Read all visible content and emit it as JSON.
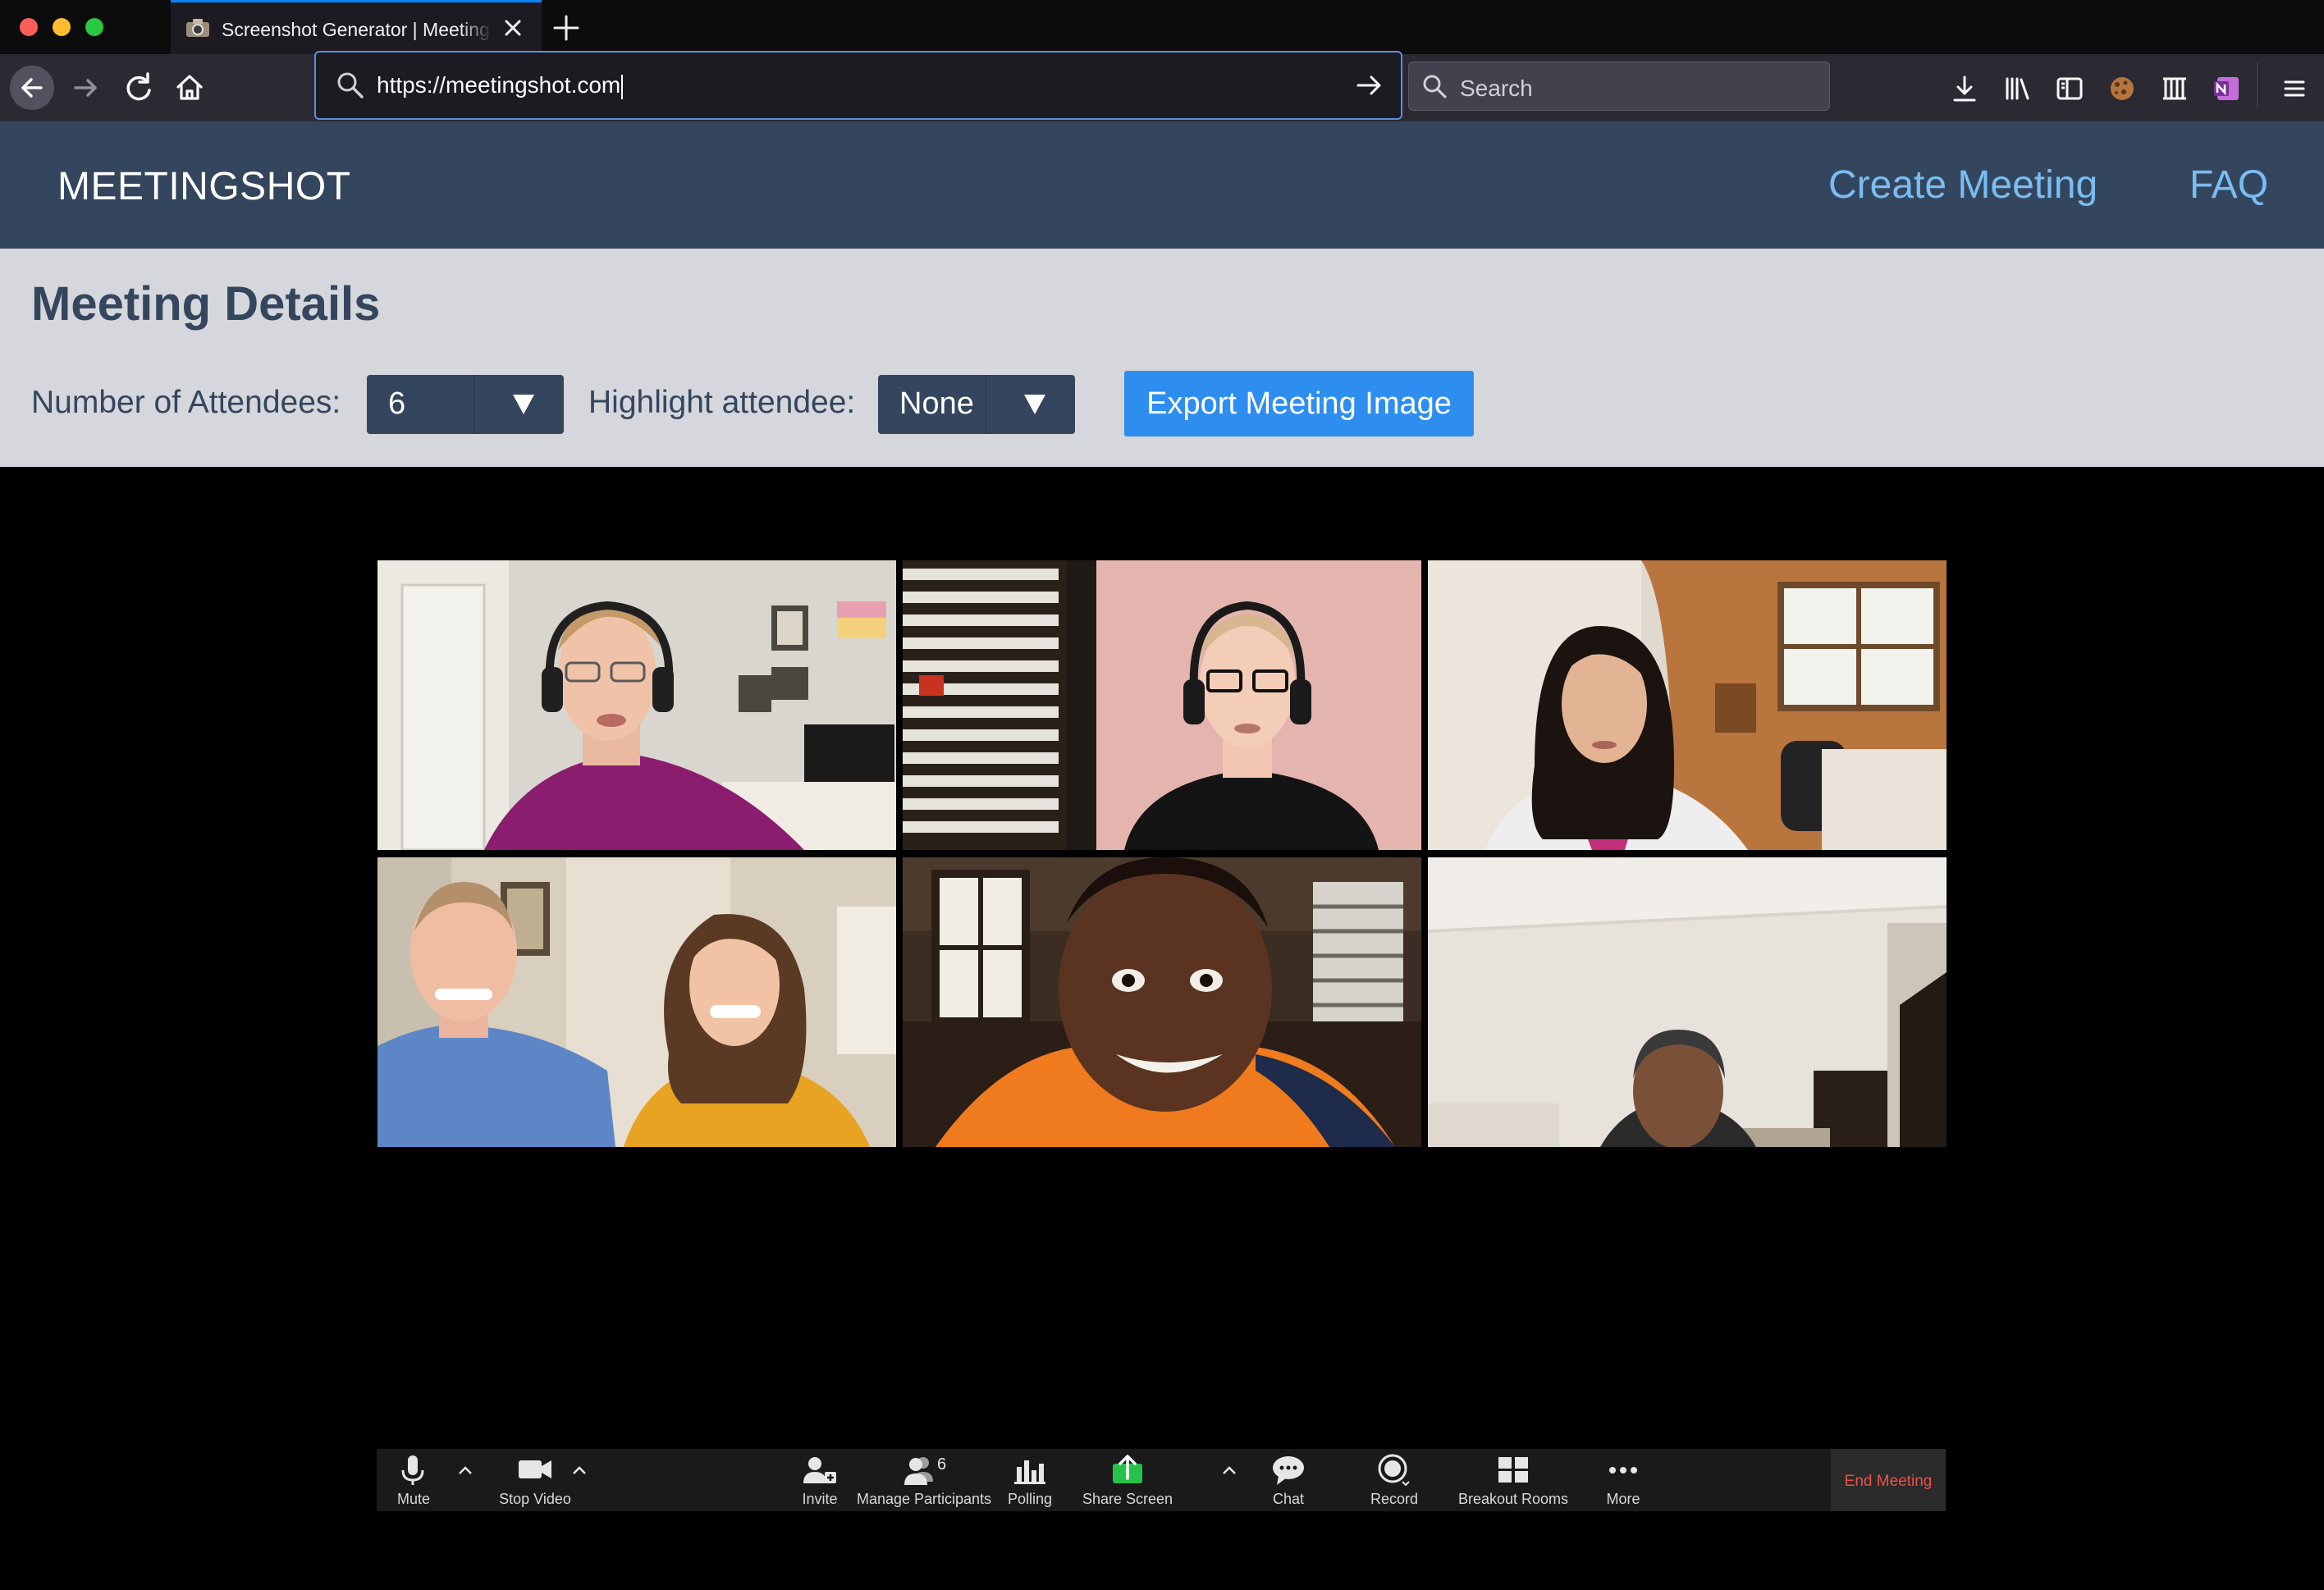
{
  "browser": {
    "tab_title": "Screenshot Generator | Meeting",
    "url": "https://meetingshot.com",
    "search_placeholder": "Search"
  },
  "site": {
    "brand": "MEETINGSHOT",
    "nav": [
      "Create Meeting",
      "FAQ"
    ],
    "colors": {
      "header": "#34465e",
      "link": "#79bdf2",
      "panel": "#d5d7dc",
      "button": "#2d8ef0"
    }
  },
  "details": {
    "title": "Meeting Details",
    "attendees_label": "Number of Attendees:",
    "attendees_value": "6",
    "highlight_label": "Highlight attendee:",
    "highlight_value": "None",
    "export_label": "Export Meeting Image"
  },
  "zoom_toolbar": {
    "items": [
      "Mute",
      "Stop Video",
      "Invite",
      "Manage Participants",
      "Polling",
      "Share Screen",
      "Chat",
      "Record",
      "Breakout Rooms",
      "More"
    ],
    "participant_count": "6",
    "end_label": "End Meeting",
    "colors": {
      "share": "#27c24a",
      "end": "#e8524a"
    }
  },
  "video_tiles": 6
}
